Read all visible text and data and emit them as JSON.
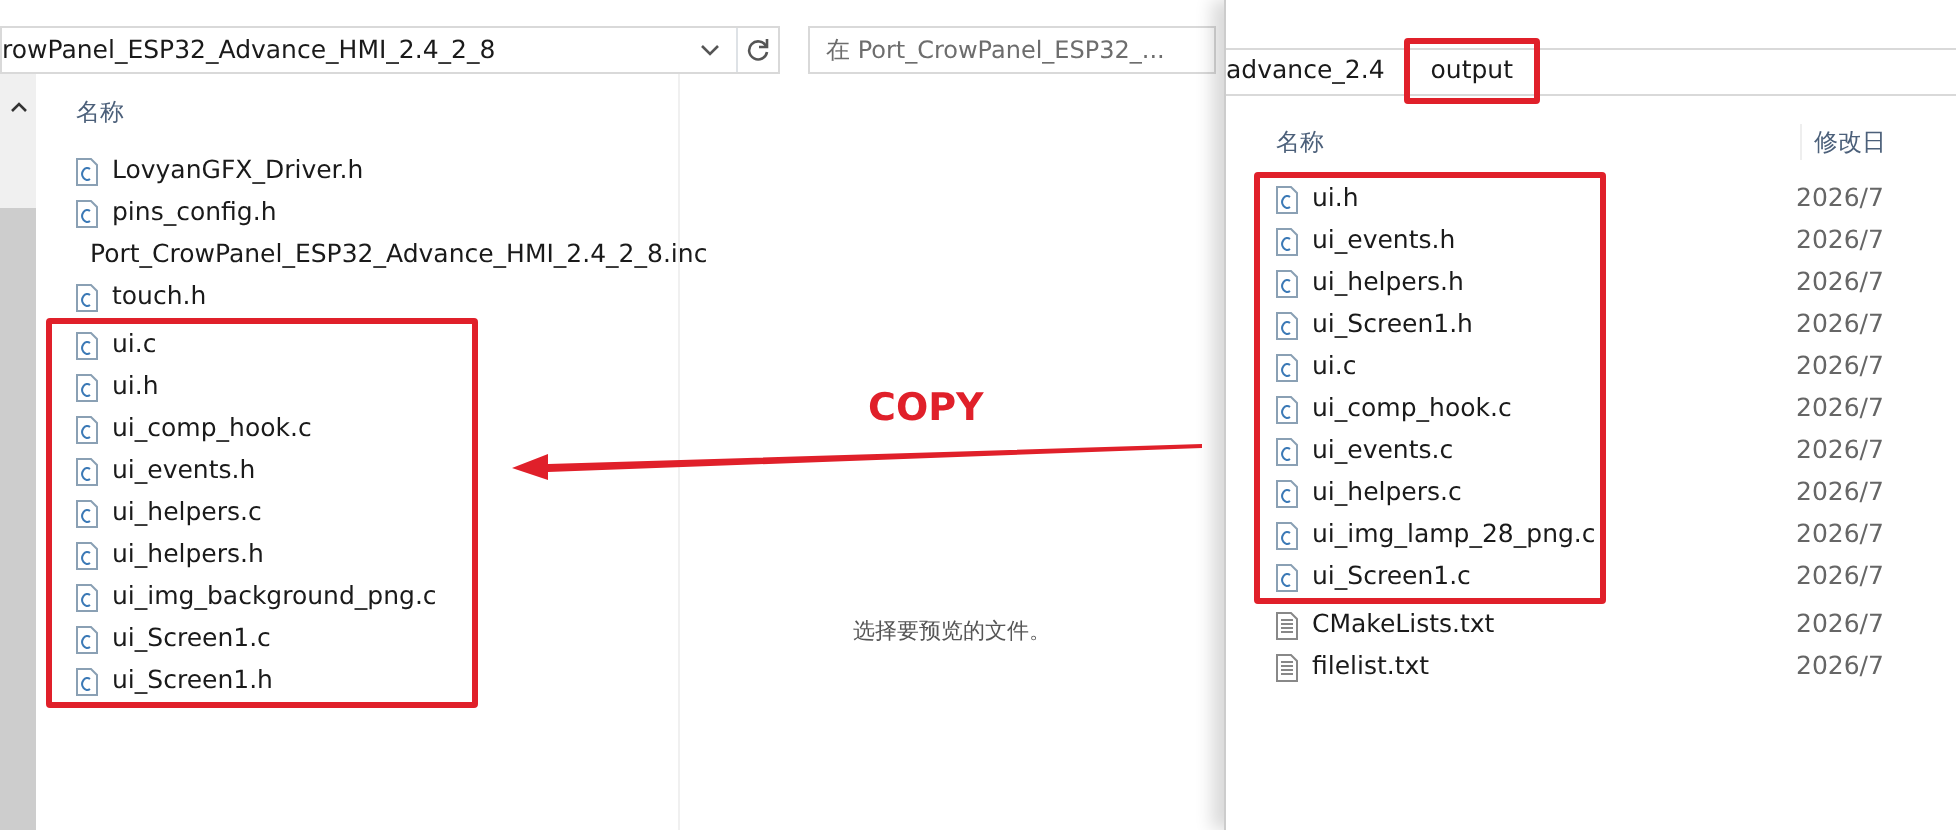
{
  "left_window": {
    "address": "rowPanel_ESP32_Advance_HMI_2.4_2_8",
    "search": {
      "placeholder": "在 Port_CrowPanel_ESP32_..."
    },
    "columns": [
      "名称"
    ],
    "file_groups": [
      {
        "highlighted": false,
        "files": [
          {
            "name": "LovyanGFX_Driver.h",
            "kind": "c"
          },
          {
            "name": "pins_config.h",
            "kind": "c"
          },
          {
            "name": "Port_CrowPanel_ESP32_Advance_HMI_2.4_2_8.inc",
            "kind": "blank"
          },
          {
            "name": "touch.h",
            "kind": "c"
          }
        ]
      },
      {
        "highlighted": true,
        "files": [
          {
            "name": "ui.c",
            "kind": "c"
          },
          {
            "name": "ui.h",
            "kind": "c"
          },
          {
            "name": "ui_comp_hook.c",
            "kind": "c"
          },
          {
            "name": "ui_events.h",
            "kind": "c"
          },
          {
            "name": "ui_helpers.c",
            "kind": "c"
          },
          {
            "name": "ui_helpers.h",
            "kind": "c"
          },
          {
            "name": "ui_img_background_png.c",
            "kind": "c"
          },
          {
            "name": "ui_Screen1.c",
            "kind": "c"
          },
          {
            "name": "ui_Screen1.h",
            "kind": "c"
          }
        ]
      }
    ],
    "preview_message": "选择要预览的文件。"
  },
  "right_window": {
    "breadcrumbs": [
      {
        "label": "advance_2.4",
        "highlighted": false
      },
      {
        "label": "output",
        "highlighted": true
      }
    ],
    "columns": [
      "名称",
      "修改日"
    ],
    "file_groups": [
      {
        "highlighted": true,
        "files": [
          {
            "name": "ui.h",
            "kind": "c",
            "date": "2026/7"
          },
          {
            "name": "ui_events.h",
            "kind": "c",
            "date": "2026/7"
          },
          {
            "name": "ui_helpers.h",
            "kind": "c",
            "date": "2026/7"
          },
          {
            "name": "ui_Screen1.h",
            "kind": "c",
            "date": "2026/7"
          },
          {
            "name": "ui.c",
            "kind": "c",
            "date": "2026/7"
          },
          {
            "name": "ui_comp_hook.c",
            "kind": "c",
            "date": "2026/7"
          },
          {
            "name": "ui_events.c",
            "kind": "c",
            "date": "2026/7"
          },
          {
            "name": "ui_helpers.c",
            "kind": "c",
            "date": "2026/7"
          },
          {
            "name": "ui_img_lamp_28_png.c",
            "kind": "c",
            "date": "2026/7"
          },
          {
            "name": "ui_Screen1.c",
            "kind": "c",
            "date": "2026/7"
          }
        ]
      },
      {
        "highlighted": false,
        "files": [
          {
            "name": "CMakeLists.txt",
            "kind": "text",
            "date": "2026/7"
          },
          {
            "name": "filelist.txt",
            "kind": "text",
            "date": "2026/7"
          }
        ]
      }
    ]
  },
  "annotation": {
    "label": "COPY"
  }
}
